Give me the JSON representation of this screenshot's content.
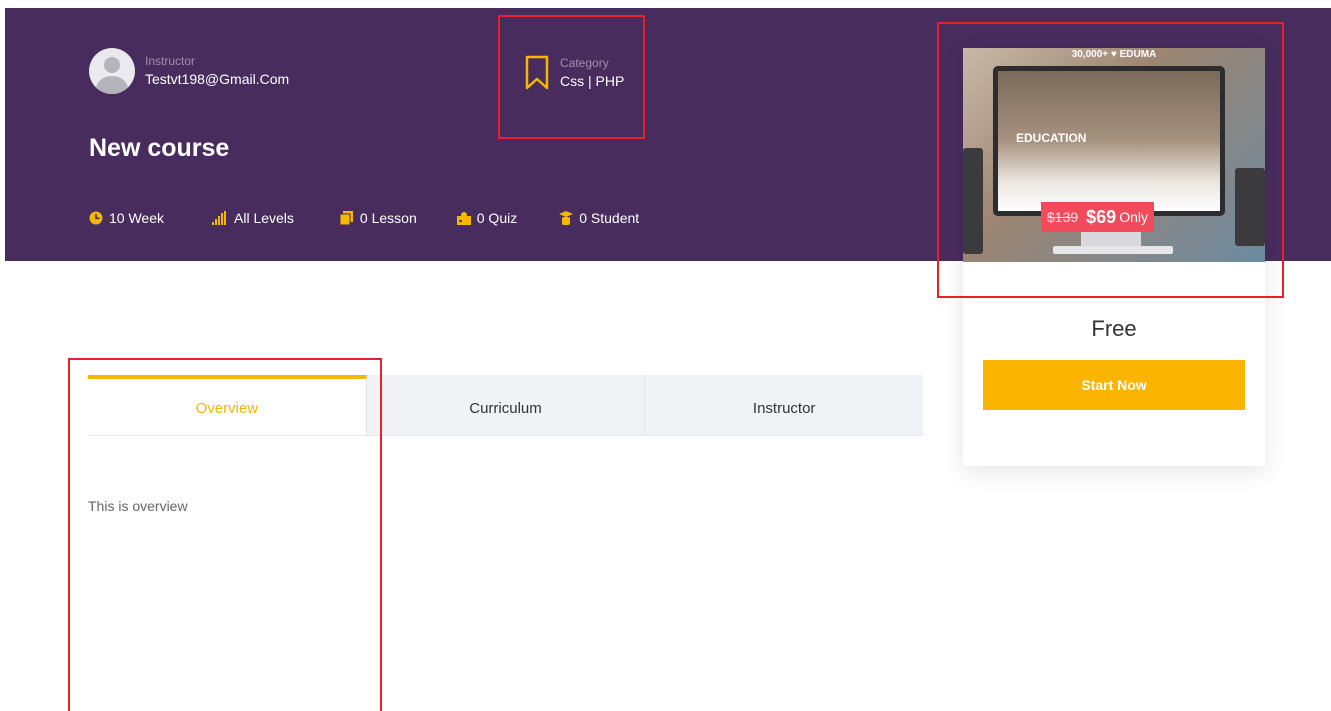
{
  "instructor": {
    "label": "Instructor",
    "email": "Testvt198@Gmail.Com"
  },
  "category": {
    "label": "Category",
    "value": "Css | PHP"
  },
  "course": {
    "title": "New course"
  },
  "stats": {
    "duration": "10 Week",
    "level": "All Levels",
    "lessons": "0 Lesson",
    "quizzes": "0 Quiz",
    "students": "0 Student"
  },
  "tabs": [
    {
      "label": "Overview",
      "active": true
    },
    {
      "label": "Curriculum",
      "active": false
    },
    {
      "label": "Instructor",
      "active": false
    }
  ],
  "overview": {
    "text": "This is overview"
  },
  "sidebar": {
    "promo": {
      "top_text": "30,000+ ♥ EDUMA",
      "screen_text": "EDUCATION",
      "old_price": "$139",
      "new_price": "$69",
      "suffix": "Only"
    },
    "price": "Free",
    "button": "Start Now"
  },
  "colors": {
    "hero_bg": "#482c5e",
    "accent": "#f5b800",
    "button": "#fbb400",
    "highlight_box": "#e8202a",
    "promo_tag": "#f04a5b"
  }
}
